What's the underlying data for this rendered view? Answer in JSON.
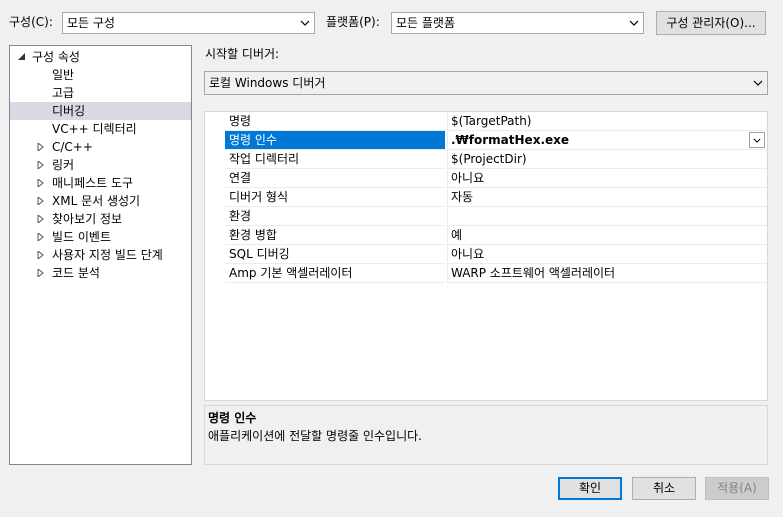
{
  "header": {
    "config_label": "구성(C):",
    "config_value": "모든 구성",
    "platform_label": "플랫폼(P):",
    "platform_value": "모든 플랫폼",
    "config_manager_button": "구성 관리자(O)..."
  },
  "tree": {
    "root": "구성 속성",
    "items": [
      {
        "label": "일반",
        "expandable": false
      },
      {
        "label": "고급",
        "expandable": false
      },
      {
        "label": "디버깅",
        "expandable": false,
        "selected": true
      },
      {
        "label": "VC++ 디렉터리",
        "expandable": false
      },
      {
        "label": "C/C++",
        "expandable": true
      },
      {
        "label": "링커",
        "expandable": true
      },
      {
        "label": "매니페스트 도구",
        "expandable": true
      },
      {
        "label": "XML 문서 생성기",
        "expandable": true
      },
      {
        "label": "찾아보기 정보",
        "expandable": true
      },
      {
        "label": "빌드 이벤트",
        "expandable": true
      },
      {
        "label": "사용자 지정 빌드 단계",
        "expandable": true
      },
      {
        "label": "코드 분석",
        "expandable": true
      }
    ]
  },
  "debugger": {
    "label": "시작할 디버거:",
    "value": "로컬 Windows 디버거"
  },
  "properties": [
    {
      "name": "명령",
      "value": "$(TargetPath)"
    },
    {
      "name": "명령 인수",
      "value": ".₩formatHex.exe",
      "selected": true
    },
    {
      "name": "작업 디렉터리",
      "value": "$(ProjectDir)"
    },
    {
      "name": "연결",
      "value": "아니요"
    },
    {
      "name": "디버거 형식",
      "value": "자동"
    },
    {
      "name": "환경",
      "value": ""
    },
    {
      "name": "환경 병합",
      "value": "예"
    },
    {
      "name": "SQL 디버깅",
      "value": "아니요"
    },
    {
      "name": "Amp 기본 액셀러레이터",
      "value": "WARP 소프트웨어 액셀러레이터"
    }
  ],
  "description": {
    "title": "명령 인수",
    "text": "애플리케이션에 전달할 명령줄 인수입니다."
  },
  "buttons": {
    "ok": "확인",
    "cancel": "취소",
    "apply": "적용(A)"
  },
  "colors": {
    "selection": "#0078d7",
    "tree_selection": "#d9d9e3"
  }
}
